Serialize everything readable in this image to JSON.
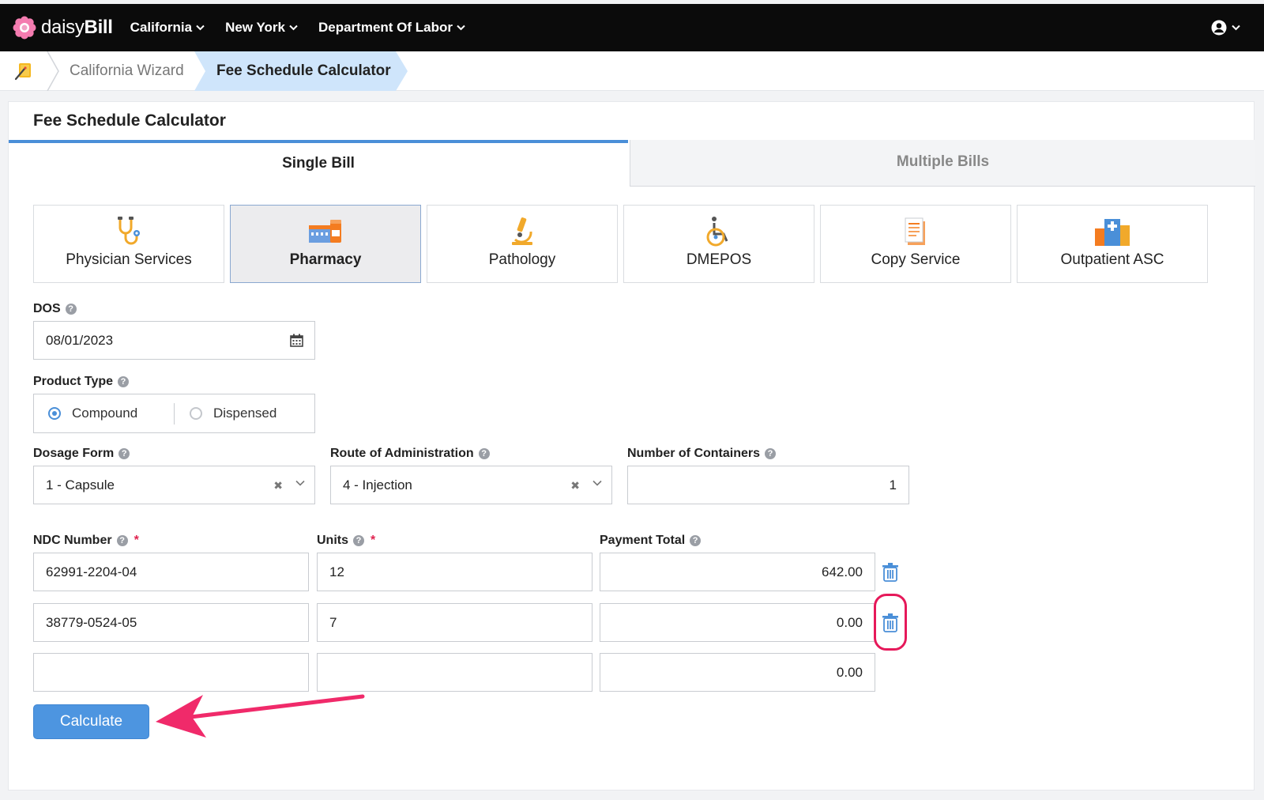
{
  "brand": {
    "name_light": "daisy",
    "name_bold": "Bill"
  },
  "nav": {
    "items": [
      {
        "label": "California"
      },
      {
        "label": "New York"
      },
      {
        "label": "Department Of Labor"
      }
    ]
  },
  "breadcrumb": {
    "items": [
      "California Wizard",
      "Fee Schedule Calculator"
    ]
  },
  "page": {
    "title": "Fee Schedule Calculator",
    "tabs": [
      {
        "label": "Single Bill",
        "active": true
      },
      {
        "label": "Multiple Bills",
        "active": false
      }
    ]
  },
  "categories": [
    {
      "label": "Physician Services",
      "icon": "stethoscope-icon"
    },
    {
      "label": "Pharmacy",
      "icon": "pharmacy-icon",
      "active": true
    },
    {
      "label": "Pathology",
      "icon": "microscope-icon"
    },
    {
      "label": "DMEPOS",
      "icon": "wheelchair-icon"
    },
    {
      "label": "Copy Service",
      "icon": "document-icon"
    },
    {
      "label": "Outpatient ASC",
      "icon": "hospital-icon"
    }
  ],
  "form": {
    "dos": {
      "label": "DOS",
      "value": "08/01/2023"
    },
    "product_type": {
      "label": "Product Type",
      "options": [
        "Compound",
        "Dispensed"
      ],
      "selected": "Compound"
    },
    "dosage_form": {
      "label": "Dosage Form",
      "value": "1 - Capsule"
    },
    "route": {
      "label": "Route of Administration",
      "value": "4 - Injection"
    },
    "containers": {
      "label": "Number of Containers",
      "value": "1"
    },
    "lines": {
      "headers": {
        "ndc": "NDC Number",
        "units": "Units",
        "payment": "Payment Total",
        "required_mark": "*"
      },
      "rows": [
        {
          "ndc": "62991-2204-04",
          "units": "12",
          "payment": "642.00"
        },
        {
          "ndc": "38779-0524-05",
          "units": "7",
          "payment": "0.00"
        },
        {
          "ndc": "",
          "units": "",
          "payment": "0.00"
        }
      ]
    },
    "calculate_label": "Calculate"
  },
  "colors": {
    "accent": "#4a8fd8",
    "annotation": "#e6195a",
    "topbar": "#0b0b0b"
  }
}
